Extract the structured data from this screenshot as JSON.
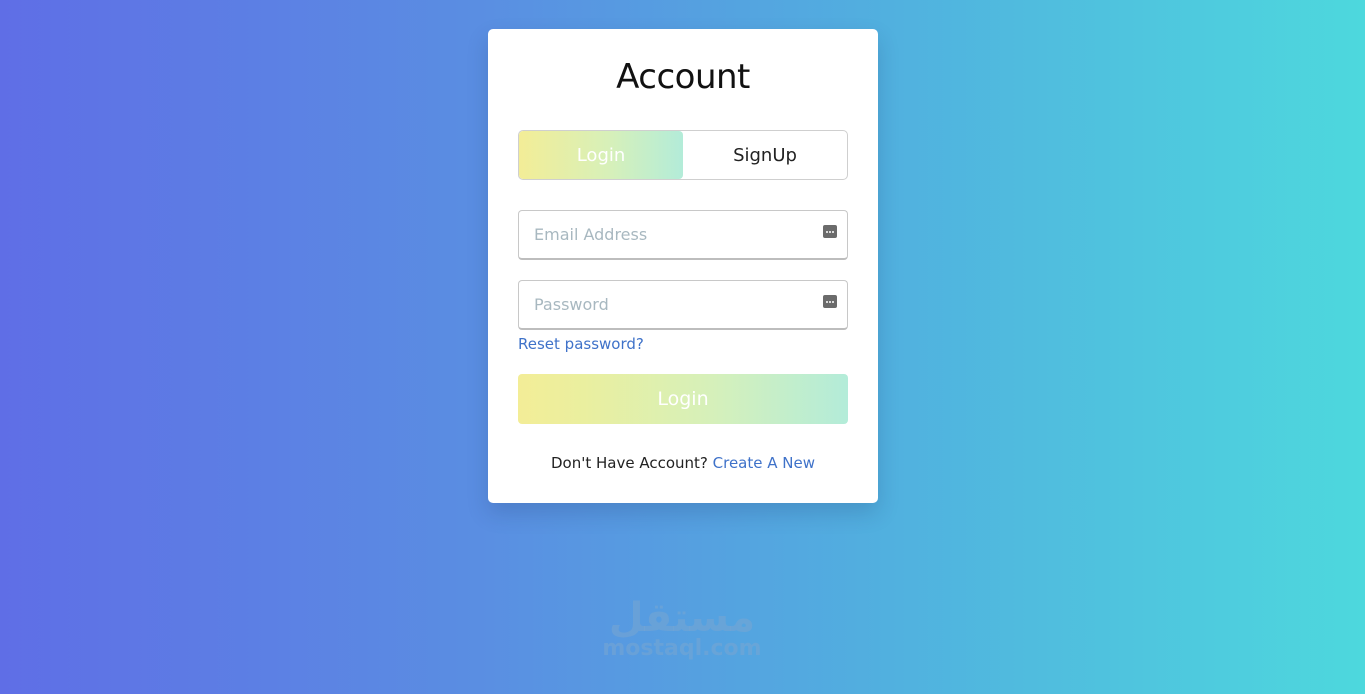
{
  "card": {
    "title": "Account",
    "tabs": [
      {
        "label": "Login",
        "active": true
      },
      {
        "label": "SignUp",
        "active": false
      }
    ],
    "email": {
      "placeholder": "Email Address",
      "value": "",
      "icon": "key-icon"
    },
    "password": {
      "placeholder": "Password",
      "value": "",
      "icon": "key-icon"
    },
    "reset_link": "Reset password?",
    "submit_label": "Login",
    "footer": {
      "text": "Don't Have Account?",
      "link": "Create A New"
    }
  },
  "watermark": {
    "arabic": "مستقل",
    "latin": "mostaql.com"
  },
  "colors": {
    "background_start": "#5f6ee6",
    "background_end": "#4dd8dd",
    "button_gradient_start": "#f3ed97",
    "button_gradient_end": "#b3ecd9",
    "link": "#3f72c9"
  }
}
